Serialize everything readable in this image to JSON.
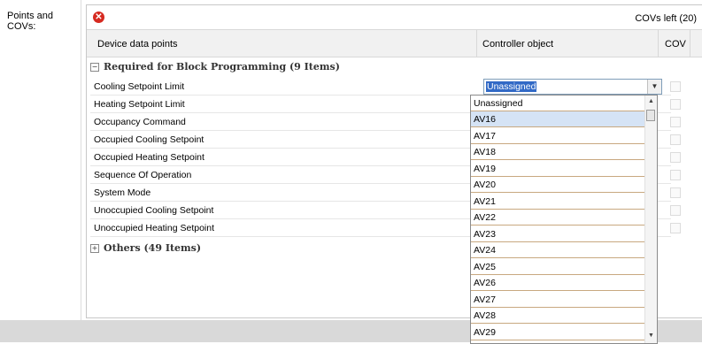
{
  "side_label": "Points and COVs:",
  "covs_left": "COVs left (20)",
  "icons": {
    "error": "error-x-icon",
    "collapse": "minus-box-icon",
    "expand": "plus-box-icon"
  },
  "columns": {
    "points": "Device data points",
    "object": "Controller object",
    "cov": "COV"
  },
  "required_group": {
    "label": "Required for Block Programming (9 Items)",
    "rows": [
      "Cooling Setpoint Limit",
      "Heating Setpoint Limit",
      "Occupancy Command",
      "Occupied Cooling Setpoint",
      "Occupied Heating Setpoint",
      "Sequence Of Operation",
      "System Mode",
      "Unoccupied Cooling Setpoint",
      "Unoccupied Heating Setpoint"
    ]
  },
  "others_group": {
    "label": "Others (49 Items)"
  },
  "combo": {
    "value": "Unassigned"
  },
  "dropdown": {
    "options": [
      "Unassigned",
      "AV16",
      "AV17",
      "AV18",
      "AV19",
      "AV20",
      "AV21",
      "AV22",
      "AV23",
      "AV24",
      "AV25",
      "AV26",
      "AV27",
      "AV28",
      "AV29"
    ],
    "selected": "AV16"
  },
  "colors": {
    "selection": "#3169c6",
    "error": "#d62a20",
    "hover": "#d5e3f5"
  }
}
